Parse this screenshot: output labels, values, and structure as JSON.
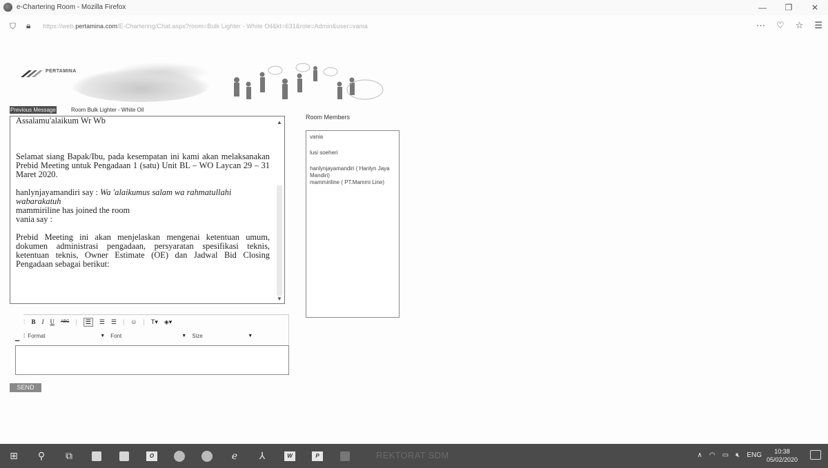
{
  "window": {
    "title": "e-Chartering Room - Mozilla Firefox",
    "url_prefix": "https://web.",
    "url_domain": "pertamina.com",
    "url_rest": "/E-Chartering/Chat.aspx?room=Bulk Lighter - White Oil&kt=631&role=Admin&user=vania"
  },
  "banner": {
    "brand": "PERTAMINA"
  },
  "tabs": {
    "previous": "Previous Message",
    "room": "Room Bulk Lighter - White Oil"
  },
  "chat": {
    "greeting": "Assalamu'alaikum Wr Wb",
    "announcement": "Selamat siang Bapak/Ibu, pada kesempatan ini kami akan melaksanakan Prebid Meeting untuk Pengadaan 1 (satu) Unit BL – WO Laycan 29 – 31 Maret 2020.",
    "reply_prefix": "hanlynjayamandiri say : ",
    "reply_text": "Wa 'alaikumus salam wa rahmatullahi wabarakatuh",
    "joined": "mammiriline has joined the room",
    "vania_say": "vania say :",
    "prebid": "Prebid Meeting ini akan menjelaskan mengenai ketentuan umum, dokumen administrasi pengadaan, persyaratan spesifikasi teknis, ketentuan teknis, Owner Estimate (OE) dan Jadwal Bid Closing Pengadaan sebagai berikut:"
  },
  "members": {
    "label": "Room Members",
    "items": [
      "vania",
      "lusi soeheri",
      "hanlynjayamandiri ( Hanlyn Jaya Mandiri)",
      "mammiriline ( PT.Mammi Line)"
    ]
  },
  "editor": {
    "bold": "B",
    "italic": "I",
    "underline": "U",
    "strike": "ABC",
    "format_label": "Format",
    "font_label": "Font",
    "size_label": "Size"
  },
  "send_label": "SEND",
  "taskbar": {
    "ghost_text": "REKTORAT SDM",
    "lang": "ENG",
    "time": "10:38",
    "date": "05/02/2020"
  }
}
